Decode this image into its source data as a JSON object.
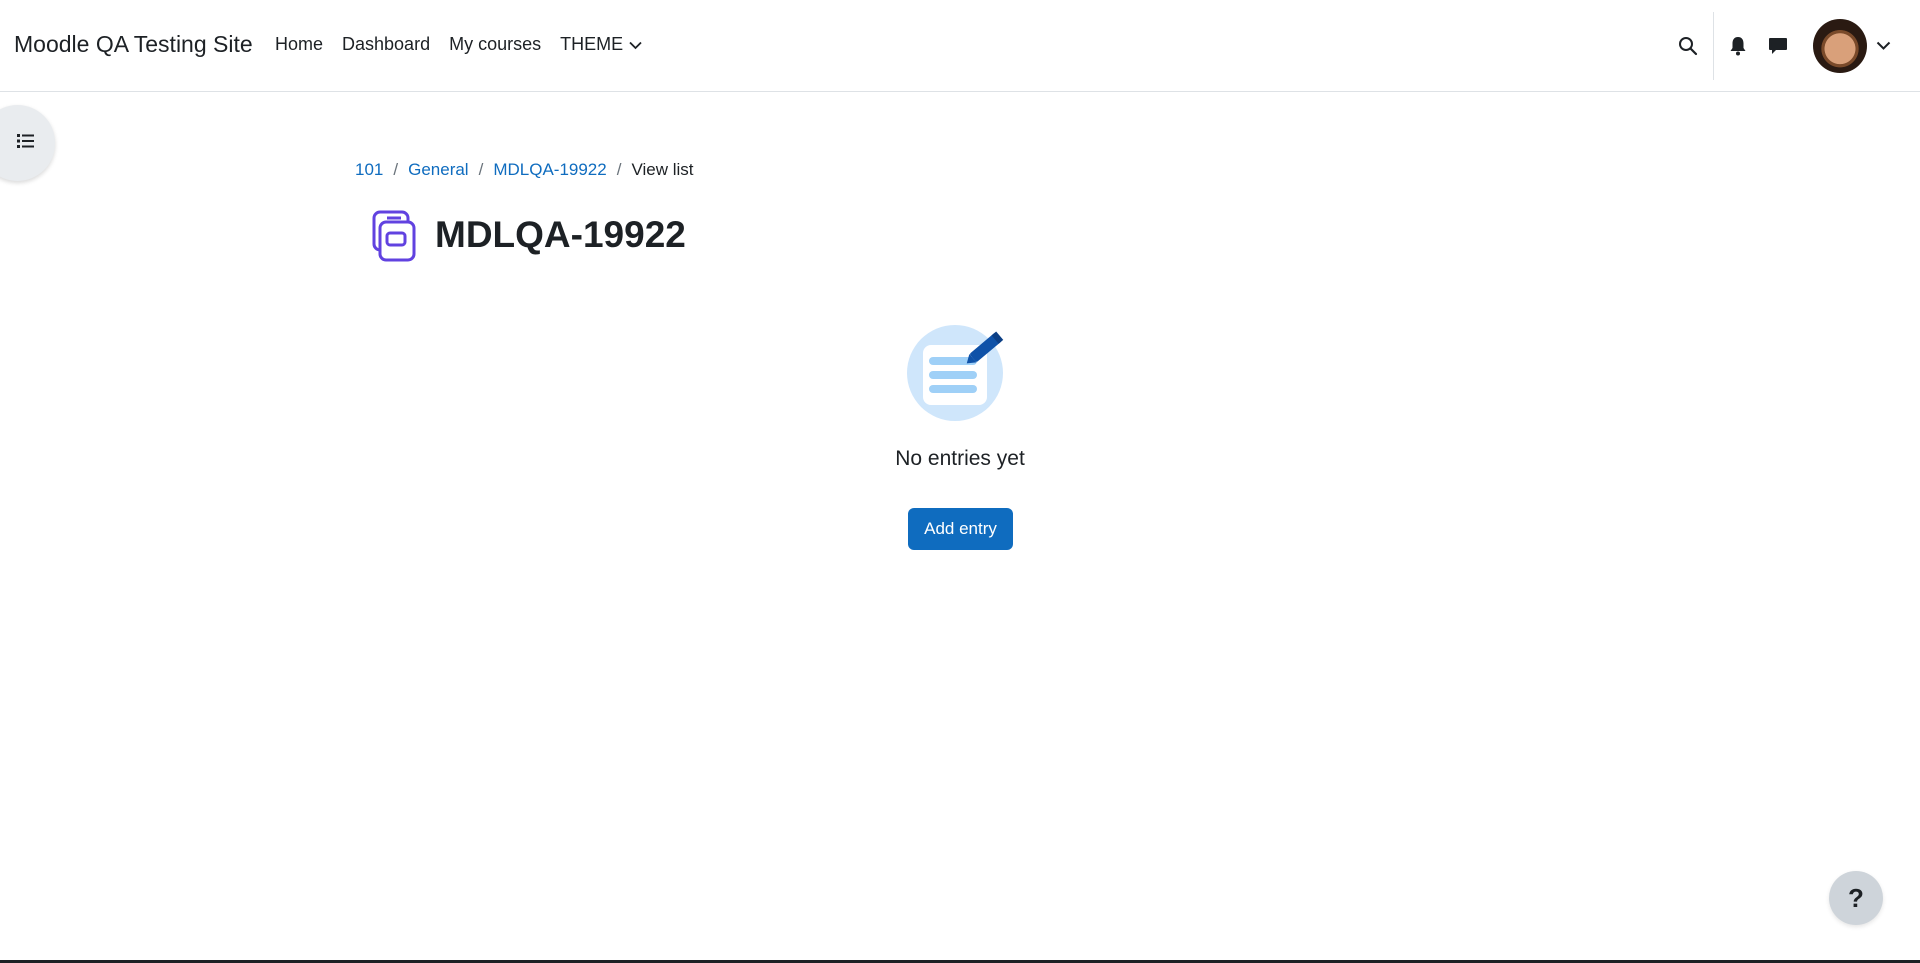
{
  "site": {
    "name": "Moodle QA Testing Site"
  },
  "nav": {
    "items": [
      {
        "label": "Home"
      },
      {
        "label": "Dashboard"
      },
      {
        "label": "My courses"
      },
      {
        "label": "THEME"
      }
    ]
  },
  "header_icons": [
    "search-icon",
    "bell-icon",
    "message-icon",
    "avatar",
    "chevron-down-icon"
  ],
  "breadcrumb": {
    "items": [
      {
        "label": "101"
      },
      {
        "label": "General"
      },
      {
        "label": "MDLQA-19922"
      }
    ],
    "current": "View list",
    "separator": "/"
  },
  "page": {
    "title": "MDLQA-19922"
  },
  "empty_state": {
    "message": "No entries yet",
    "button_label": "Add entry"
  },
  "help": {
    "label": "?"
  },
  "colors": {
    "accent": "#0f6cbf",
    "activity_icon": "#6142e0",
    "illustration_bg": "#cfe6fb",
    "text": "#1d2125"
  }
}
